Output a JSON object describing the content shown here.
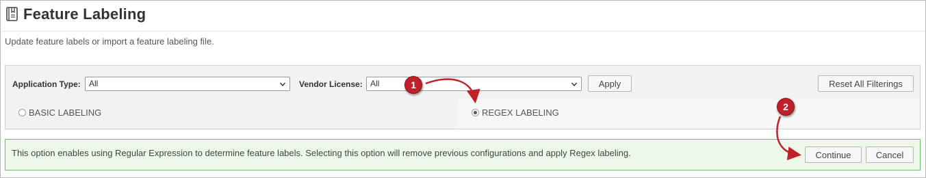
{
  "header": {
    "title": "Feature Labeling",
    "icon": "book-icon",
    "description": "Update feature labels or import a feature labeling file."
  },
  "filters": {
    "application_type_label": "Application Type:",
    "application_type_value": "All",
    "vendor_license_label": "Vendor License:",
    "vendor_license_value": "All",
    "apply_label": "Apply",
    "reset_label": "Reset All Filterings"
  },
  "labeling_mode": {
    "options": [
      {
        "label": "BASIC LABELING",
        "selected": false
      },
      {
        "label": "REGEX LABELING",
        "selected": true
      }
    ]
  },
  "notice": {
    "text": "This option enables using Regular Expression to determine feature labels. Selecting this option will remove previous configurations and apply Regex labeling.",
    "continue_label": "Continue",
    "cancel_label": "Cancel"
  },
  "callouts": [
    "1",
    "2"
  ],
  "colors": {
    "callout": "#c0202a",
    "notice_border": "#6ec067",
    "notice_bg": "#eef8ea"
  }
}
